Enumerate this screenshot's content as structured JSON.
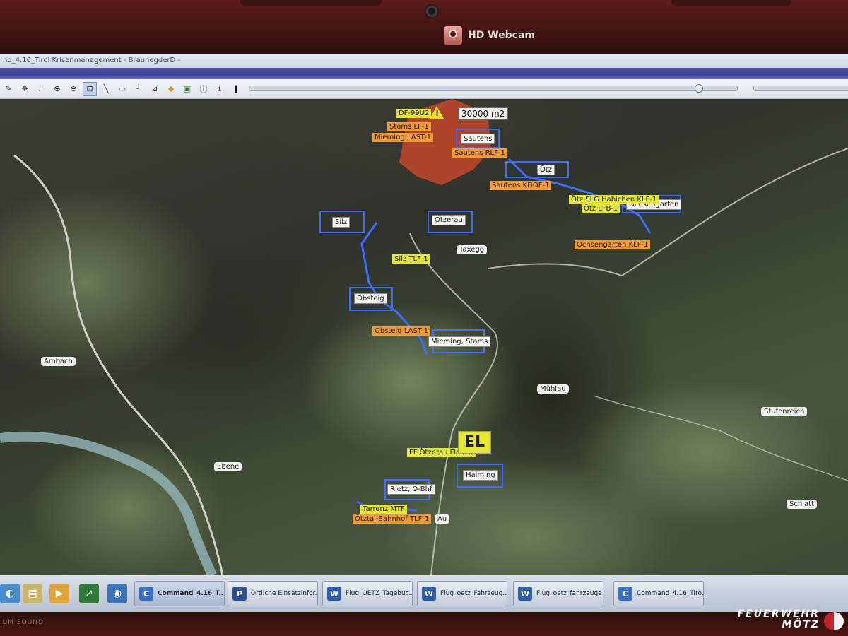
{
  "bezel": {
    "webcam_label": "HD Webcam",
    "brand_left": "IUM SOUND"
  },
  "window": {
    "title": "nd_4.16_Tirol Krisenmanagement - BraunegderD -"
  },
  "toolbar": {
    "slider_value": 0.92
  },
  "map": {
    "area": {
      "label": "30000 m2",
      "callsign": "DF-99U2"
    },
    "places": [
      "Ambach",
      "Ebene",
      "Taxegg",
      "Mühlau",
      "Stufenreich",
      "Schlatt",
      "Au"
    ],
    "units": [
      "Sautens",
      "Ötz",
      "Ochsengarten",
      "Silz",
      "Ötzerau",
      "Obsteig",
      "Mieming, Stams",
      "Haiming",
      "Rietz, Ö-Bhf"
    ],
    "tags": {
      "stams_lf": "Stams LF-1",
      "mieming_last": "Mieming LAST-1",
      "sautens_rlf": "Sautens RLF-1",
      "sautens_kdof": "Sautens KDOF-1",
      "otz_slg": "Ötz SLG Habichen KLF-1",
      "otz_lfb": "Ötz LFB-1",
      "ochsengarten_klf": "Ochsengarten KLF-1",
      "silz_tlf": "Silz TLF-1",
      "obsteig_last": "Obsteig LAST-1",
      "ff_otzerau": "FF Ötzerau Florian",
      "tarrenz_mtf": "Tarrenz MTF",
      "otztal_bhf": "Ötztal-Bahnhof TLF-1"
    },
    "el_badge": "EL"
  },
  "taskbar": {
    "items": [
      {
        "label": "Command_4.16_T...",
        "icon": "C"
      },
      {
        "label": "Örtliche Einsatzinfor...",
        "icon": "P"
      },
      {
        "label": "Flug_OETZ_Tagebuc...",
        "icon": "W"
      },
      {
        "label": "Flug_oetz_Fahrzeug...",
        "icon": "W"
      },
      {
        "label": "Flug_oetz_fahrzeuge...",
        "icon": "W"
      },
      {
        "label": "Command_4.16_Tiro...",
        "icon": "C"
      }
    ]
  },
  "watermark": {
    "line1": "FEUERWEHR",
    "line2": "MÖTZ"
  }
}
